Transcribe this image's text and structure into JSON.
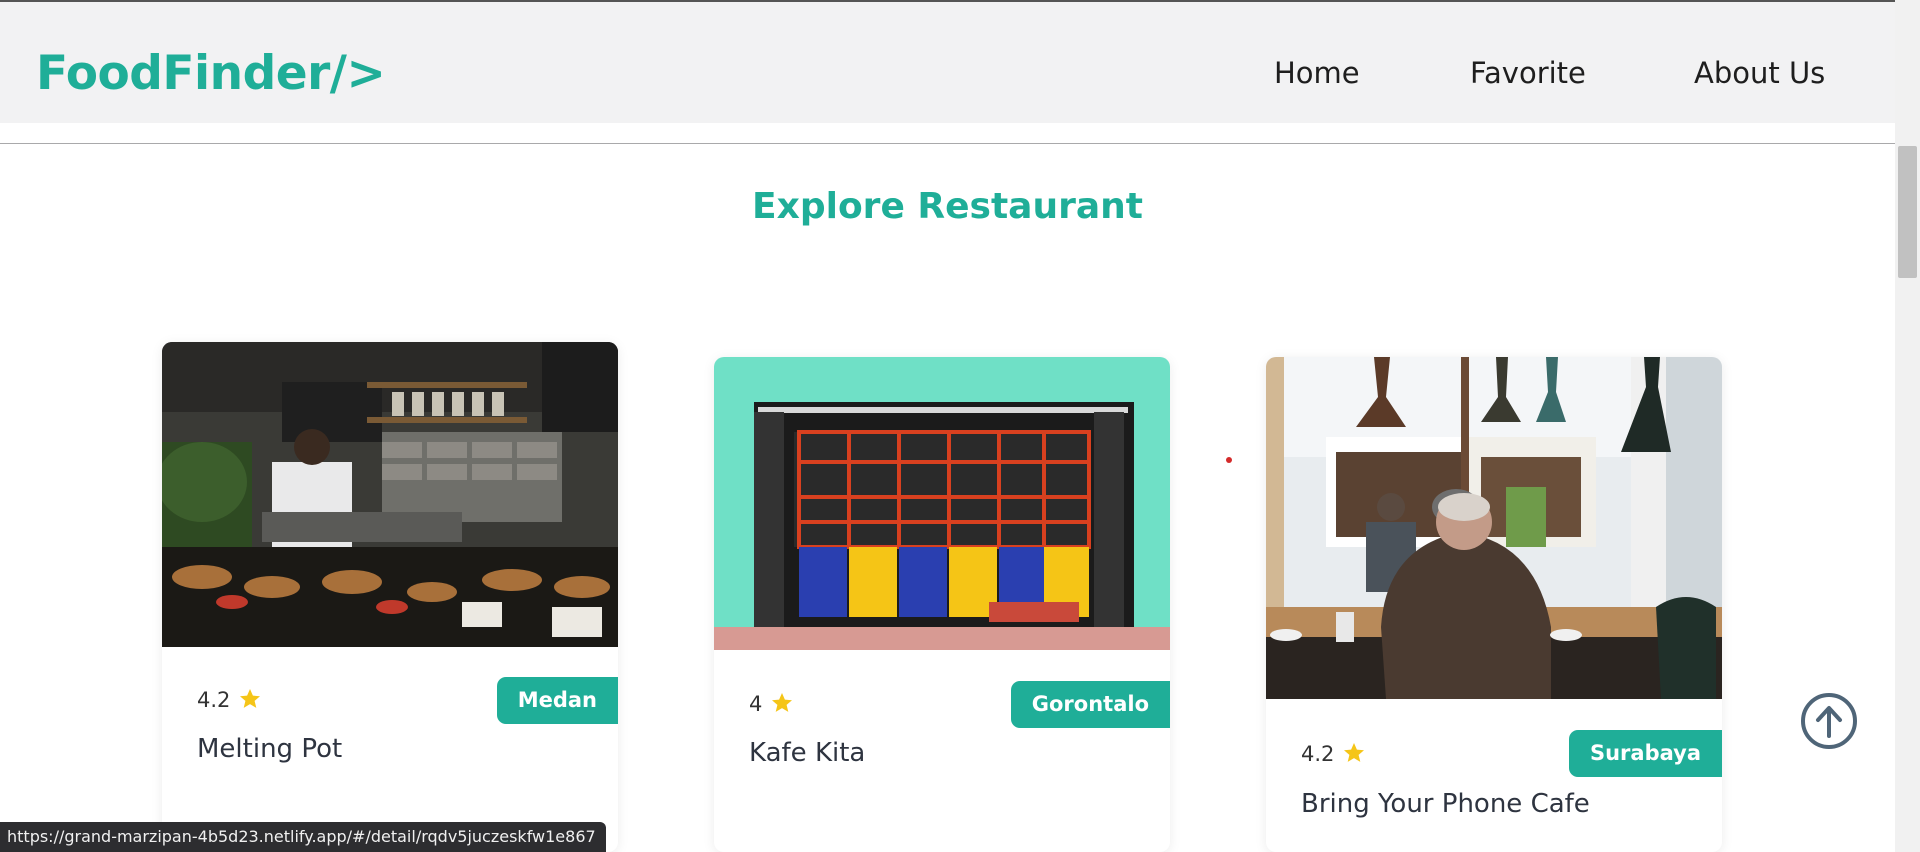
{
  "header": {
    "brand": "FoodFinder/>",
    "nav": [
      "Home",
      "Favorite",
      "About Us"
    ]
  },
  "main": {
    "title": "Explore Restaurant"
  },
  "restaurants": [
    {
      "rating": "4.2",
      "city": "Medan",
      "name": "Melting Pot",
      "image": "cafe-kitchen-counter"
    },
    {
      "rating": "4",
      "city": "Gorontalo",
      "name": "Kafe Kita",
      "image": "colorful-shopfront"
    },
    {
      "rating": "4.2",
      "city": "Surabaya",
      "name": "Bring Your Phone Cafe",
      "image": "cafe-interior-man-sitting"
    }
  ],
  "status_bar": {
    "url": "https://grand-marzipan-4b5d23.netlify.app/#/detail/rqdv5juczeskfw1e867"
  },
  "colors": {
    "accent": "#1fae98",
    "star": "#f5c518",
    "header_bg": "#f2f2f3"
  },
  "icons": [
    "star-icon",
    "arrow-up-circle-icon"
  ]
}
